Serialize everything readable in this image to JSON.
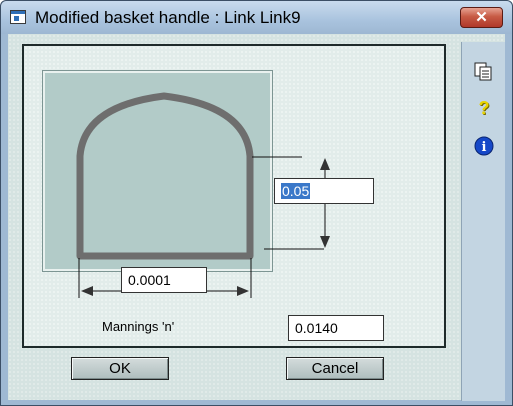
{
  "window": {
    "title": "Modified basket handle : Link Link9",
    "close_label": "✕"
  },
  "section": {
    "height_value": "0.05",
    "width_value": "0.0001",
    "mannings_label": "Mannings 'n'",
    "mannings_value": "0.0140"
  },
  "buttons": {
    "ok": "OK",
    "cancel": "Cancel"
  },
  "sidebar": {
    "icons": [
      "copy-icon",
      "help-icon",
      "info-icon"
    ],
    "help_glyph": "?",
    "info_glyph": "i"
  },
  "colors": {
    "shape_stroke": "#6e6e6e",
    "selection": "#3a78c9",
    "info_blue": "#1648c8",
    "help_yellow": "#e8d400"
  }
}
